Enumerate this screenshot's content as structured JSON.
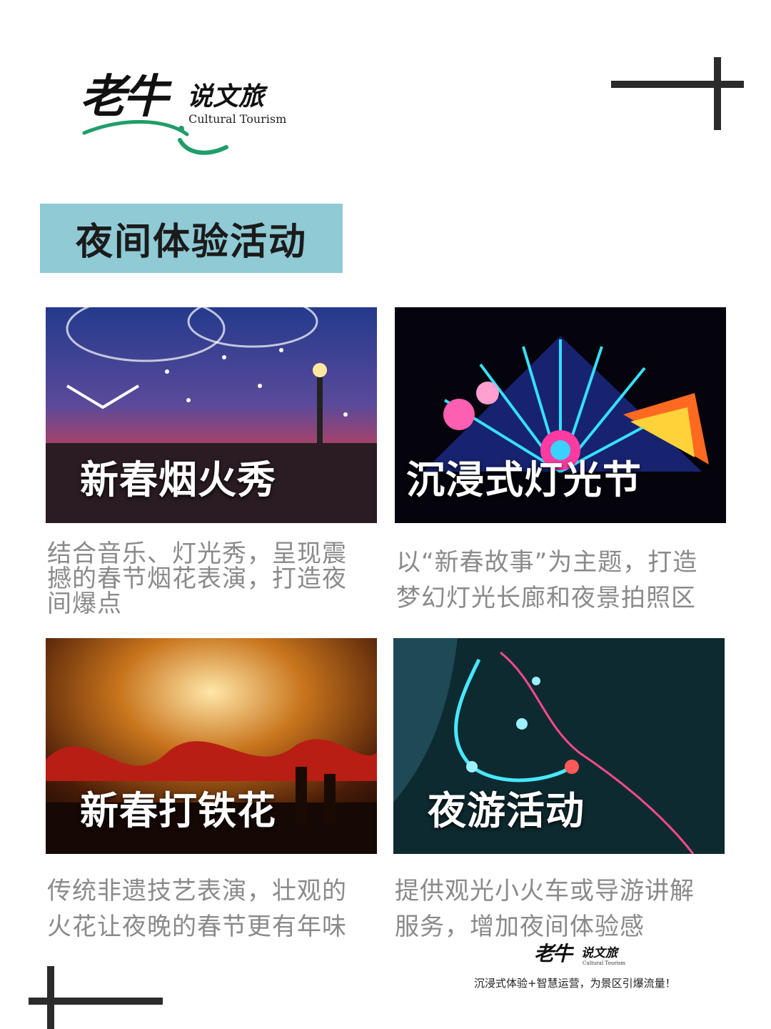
{
  "logo": {
    "cn_big": "老牛",
    "cn_small": "说文旅",
    "en": "Cultural Tourism"
  },
  "banner": {
    "title": "夜间体验活动",
    "color": "#8fcad5"
  },
  "cards": [
    {
      "caption": "新春烟火秀",
      "description": "结合音乐、灯光秀，呈现震撼的春节烟花表演，打造夜间爆点",
      "image": "new-year-fireworks-show-crowd"
    },
    {
      "caption": "沉浸式灯光节",
      "description": "以“新春故事”为主题，打造梦幻灯光长廊和夜景拍照区",
      "image": "immersive-lantern-fan-installation"
    },
    {
      "caption": "新春打铁花",
      "description": "传统非遗技艺表演，壮观的火花让夜晚的春节更有年味",
      "image": "molten-iron-sparks-dragon-dance"
    },
    {
      "caption": "夜游活动",
      "description": "提供观光小火车或导游讲解服务，增加夜间体验感",
      "image": "night-tour-route-map"
    }
  ],
  "footer": {
    "logo_cn_big": "老牛",
    "logo_cn_small": "说文旅",
    "logo_en": "Cultural Tourism",
    "slogan": "沉浸式体验+智慧运营，为景区引爆流量！"
  }
}
